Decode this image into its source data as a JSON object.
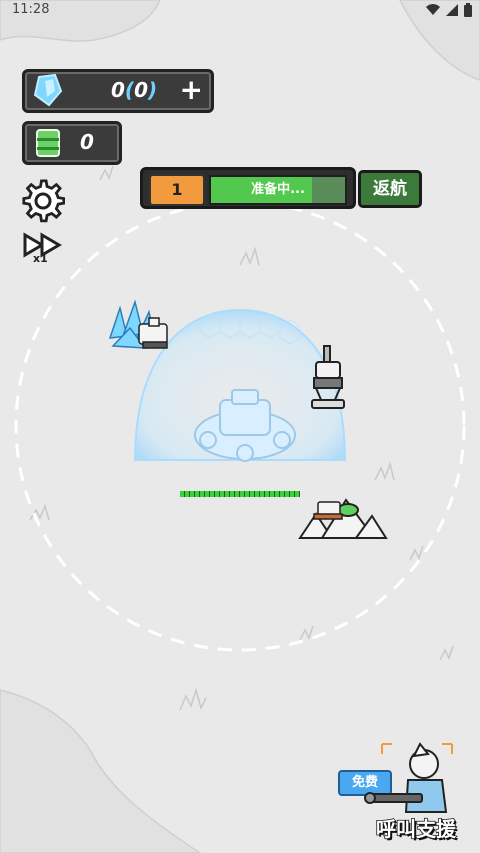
{
  "status_bar": {
    "time": "11:28"
  },
  "resources": {
    "crystal": {
      "amount": "0",
      "bracket_open": "(",
      "bonus": "0",
      "bracket_close": ")",
      "add_label": "+"
    },
    "fuel": {
      "amount": "0"
    }
  },
  "wave": {
    "number": "1",
    "status": "准备中...",
    "progress": 0.75
  },
  "return_button": {
    "label": "返航"
  },
  "speed": {
    "label": "x1"
  },
  "base": {
    "health": 1.0
  },
  "support": {
    "free_label": "免费",
    "call_label": "呼叫支援"
  },
  "colors": {
    "crystal_accent": "#6fd0ff",
    "wave_orange": "#f19a3e",
    "progress_green": "#52c84e",
    "return_green": "#3c7a3c",
    "free_blue": "#4aa8f0"
  }
}
